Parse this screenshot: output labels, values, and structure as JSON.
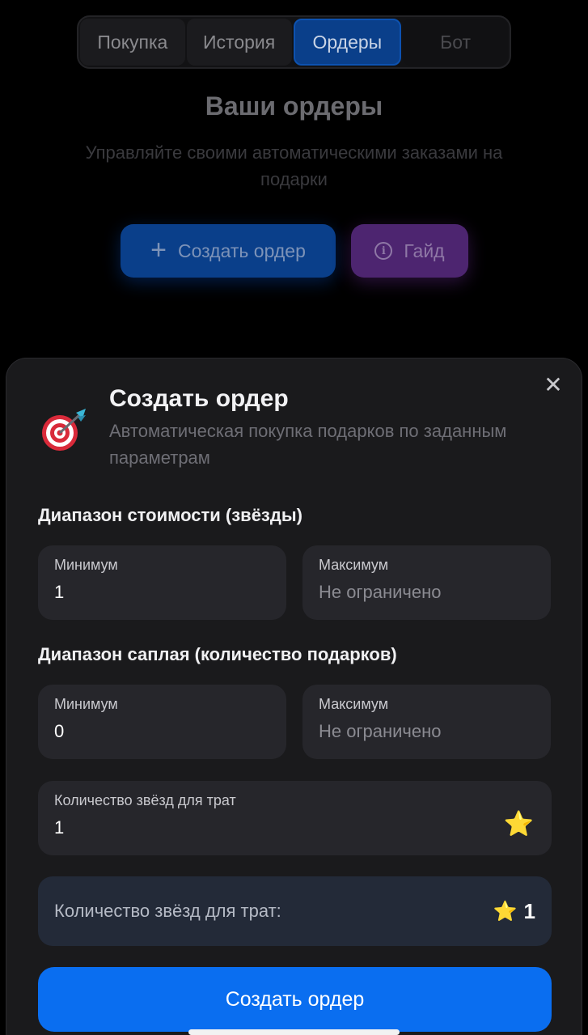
{
  "tabs": [
    {
      "label": "Покупка"
    },
    {
      "label": "История"
    },
    {
      "label": "Ордеры"
    },
    {
      "label": "Бот"
    }
  ],
  "page": {
    "title": "Ваши ордеры",
    "subtitle": "Управляйте своими автоматическими заказами на подарки",
    "create_button": "Создать ордер",
    "guide_button": "Гайд"
  },
  "sheet": {
    "title": "Создать ордер",
    "subtitle": "Автоматическая покупка подарков по заданным параметрам",
    "price_range": {
      "label": "Диапазон стоимости (звёзды)",
      "min_label": "Минимум",
      "min_value": "1",
      "max_label": "Максимум",
      "max_placeholder": "Не ограничено"
    },
    "supply_range": {
      "label": "Диапазон саплая (количество подарков)",
      "min_label": "Минимум",
      "min_value": "0",
      "max_label": "Максимум",
      "max_placeholder": "Не ограничено"
    },
    "stars_field": {
      "label": "Количество звёзд для трат",
      "value": "1"
    },
    "summary": {
      "label": "Количество звёзд для трат:",
      "value": "1"
    },
    "submit_label": "Создать ордер"
  },
  "colors": {
    "accent": "#0a6ef0",
    "sheet_bg": "#1a1a1c",
    "field_bg": "#26262b",
    "guide": "#4d2570"
  },
  "icons": [
    "close-icon",
    "dart-target-icon",
    "star-icon",
    "plus-icon",
    "info-icon"
  ]
}
